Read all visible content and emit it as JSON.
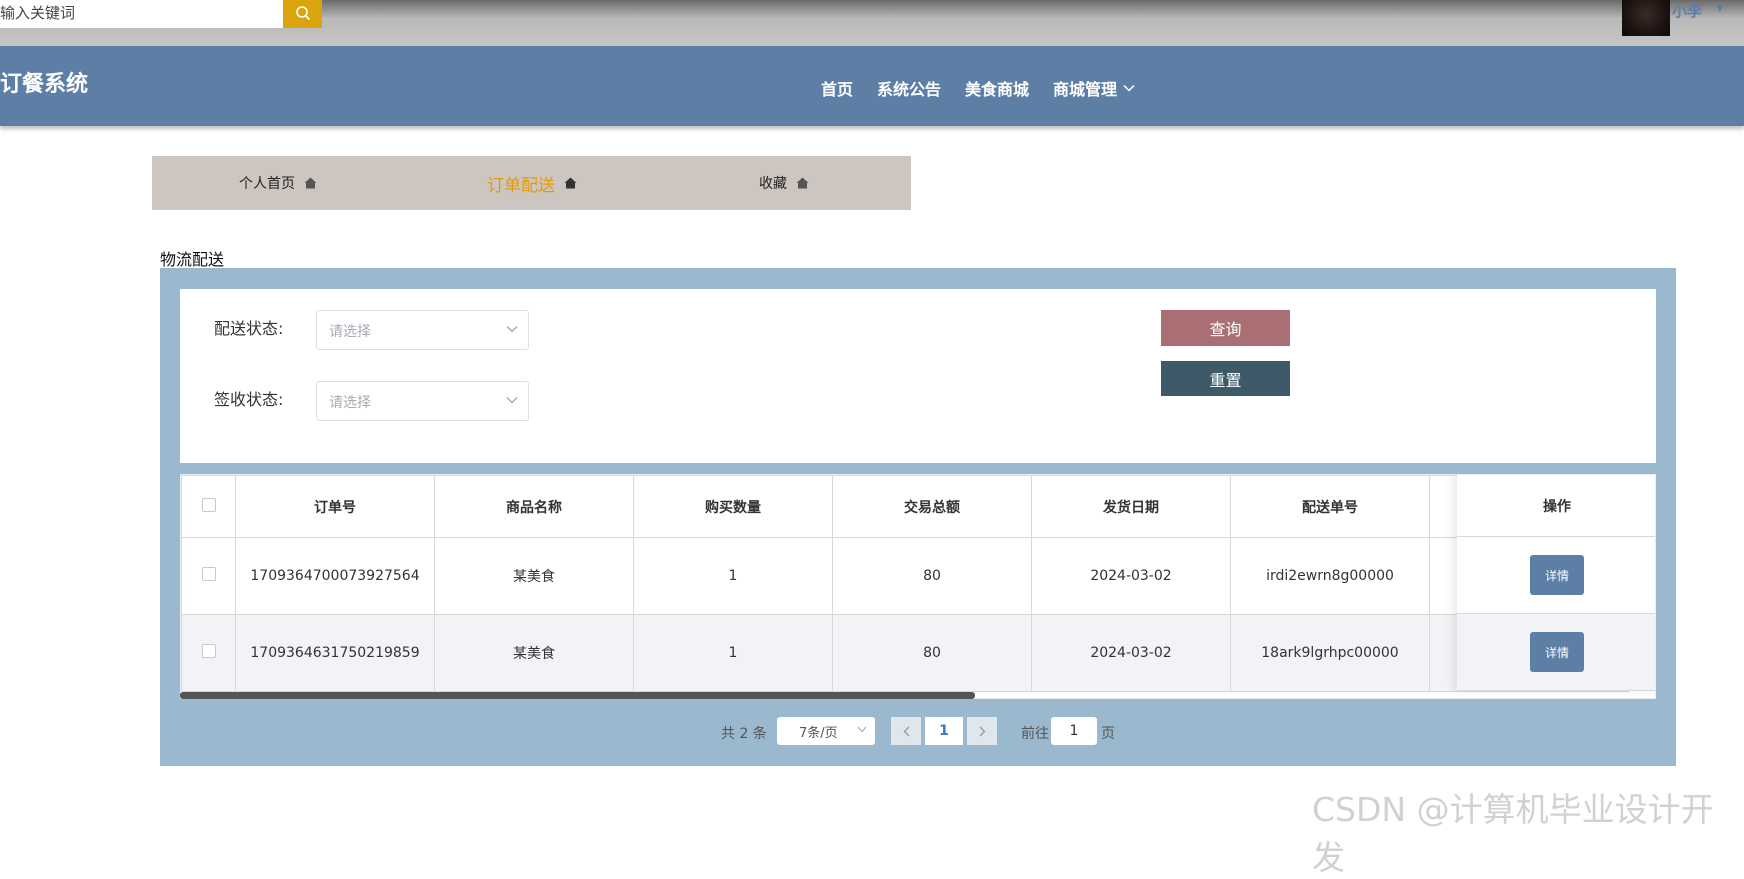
{
  "topbar": {
    "search_placeholder": "输入关键词",
    "user_name": "小李"
  },
  "nav": {
    "site_title": "订餐系统",
    "items": [
      "首页",
      "系统公告",
      "美食商城",
      "商城管理"
    ]
  },
  "subnav": {
    "tabs": [
      "个人首页",
      "订单配送",
      "收藏"
    ],
    "active_index": 1
  },
  "section_title": "物流配送",
  "filters": {
    "delivery_status_label": "配送状态:",
    "sign_status_label": "签收状态:",
    "select_placeholder": "请选择",
    "query_label": "查询",
    "reset_label": "重置"
  },
  "table": {
    "headers": [
      "订单号",
      "商品名称",
      "购买数量",
      "交易总额",
      "发货日期",
      "配送单号"
    ],
    "op_header": "操作",
    "rows": [
      {
        "order_no": "1709364700073927564",
        "product": "某美食",
        "qty": "1",
        "total": "80",
        "date": "2024-03-02",
        "delivery_no": "irdi2ewrn8g00000"
      },
      {
        "order_no": "1709364631750219859",
        "product": "某美食",
        "qty": "1",
        "total": "80",
        "date": "2024-03-02",
        "delivery_no": "18ark9lgrhpc00000"
      }
    ],
    "detail_label": "详情"
  },
  "pagination": {
    "total_text": "共 2 条",
    "page_size": "7条/页",
    "current_page": "1",
    "goto_label": "前往",
    "goto_value": "1",
    "page_suffix": "页"
  },
  "watermark": "CSDN @计算机毕业设计开发",
  "colors": {
    "nav_bg": "#5d7fa6",
    "accent_orange": "#e29b10",
    "query_btn": "#a96f73",
    "reset_btn": "#3e5a68",
    "panel_bg": "#9ab8ce"
  }
}
